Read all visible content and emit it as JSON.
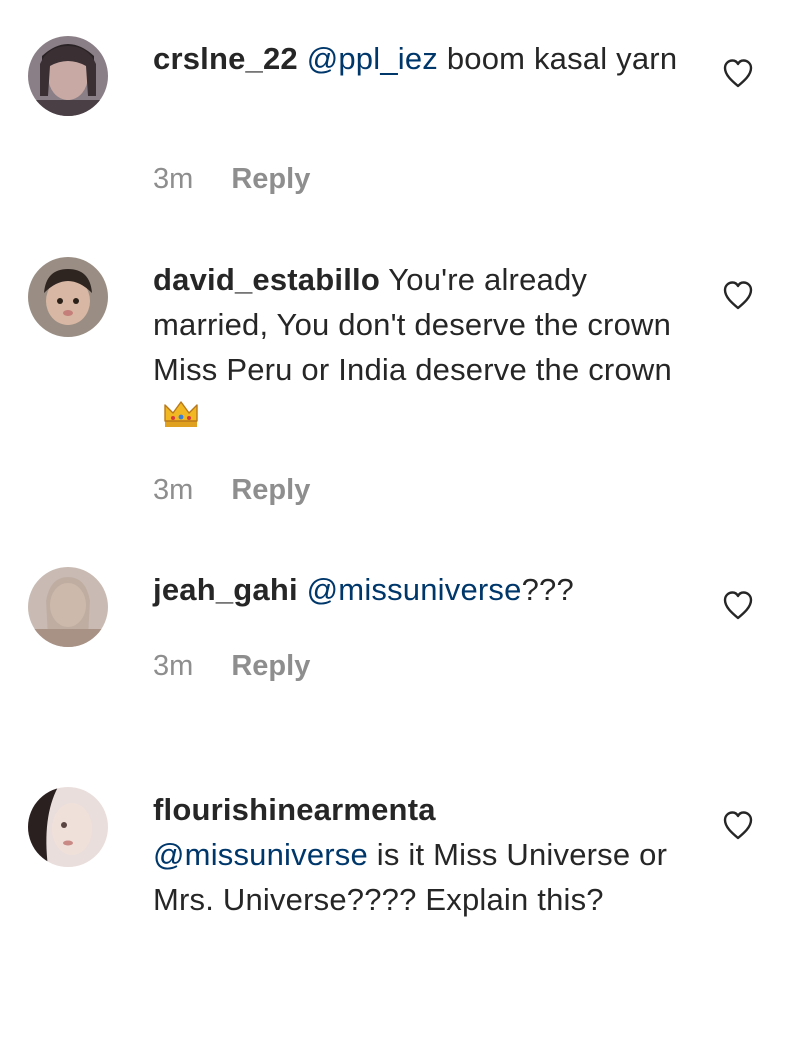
{
  "comments": [
    {
      "username": "crslne_22",
      "mention": "@ppl_iez",
      "text": " boom kasal yarn",
      "time": "3m",
      "reply": "Reply"
    },
    {
      "username": "david_estabillo",
      "text": " You're already married, You don't deserve the crown Miss Peru or India deserve the crown",
      "emoji": "crown-emoji",
      "time": "3m",
      "reply": "Reply"
    },
    {
      "username": "jeah_gahi",
      "mention": "@missuniverse",
      "text": "???",
      "time": "3m",
      "reply": "Reply"
    },
    {
      "username": "flourishinearmenta",
      "mention": "@missuniverse",
      "text": " is it Miss Universe or Mrs. Universe???? Explain this?"
    }
  ],
  "icons": {
    "like": "heart-outline-icon"
  },
  "colors": {
    "text": "#262626",
    "mention": "#00376b",
    "meta": "#8e8e8e"
  }
}
